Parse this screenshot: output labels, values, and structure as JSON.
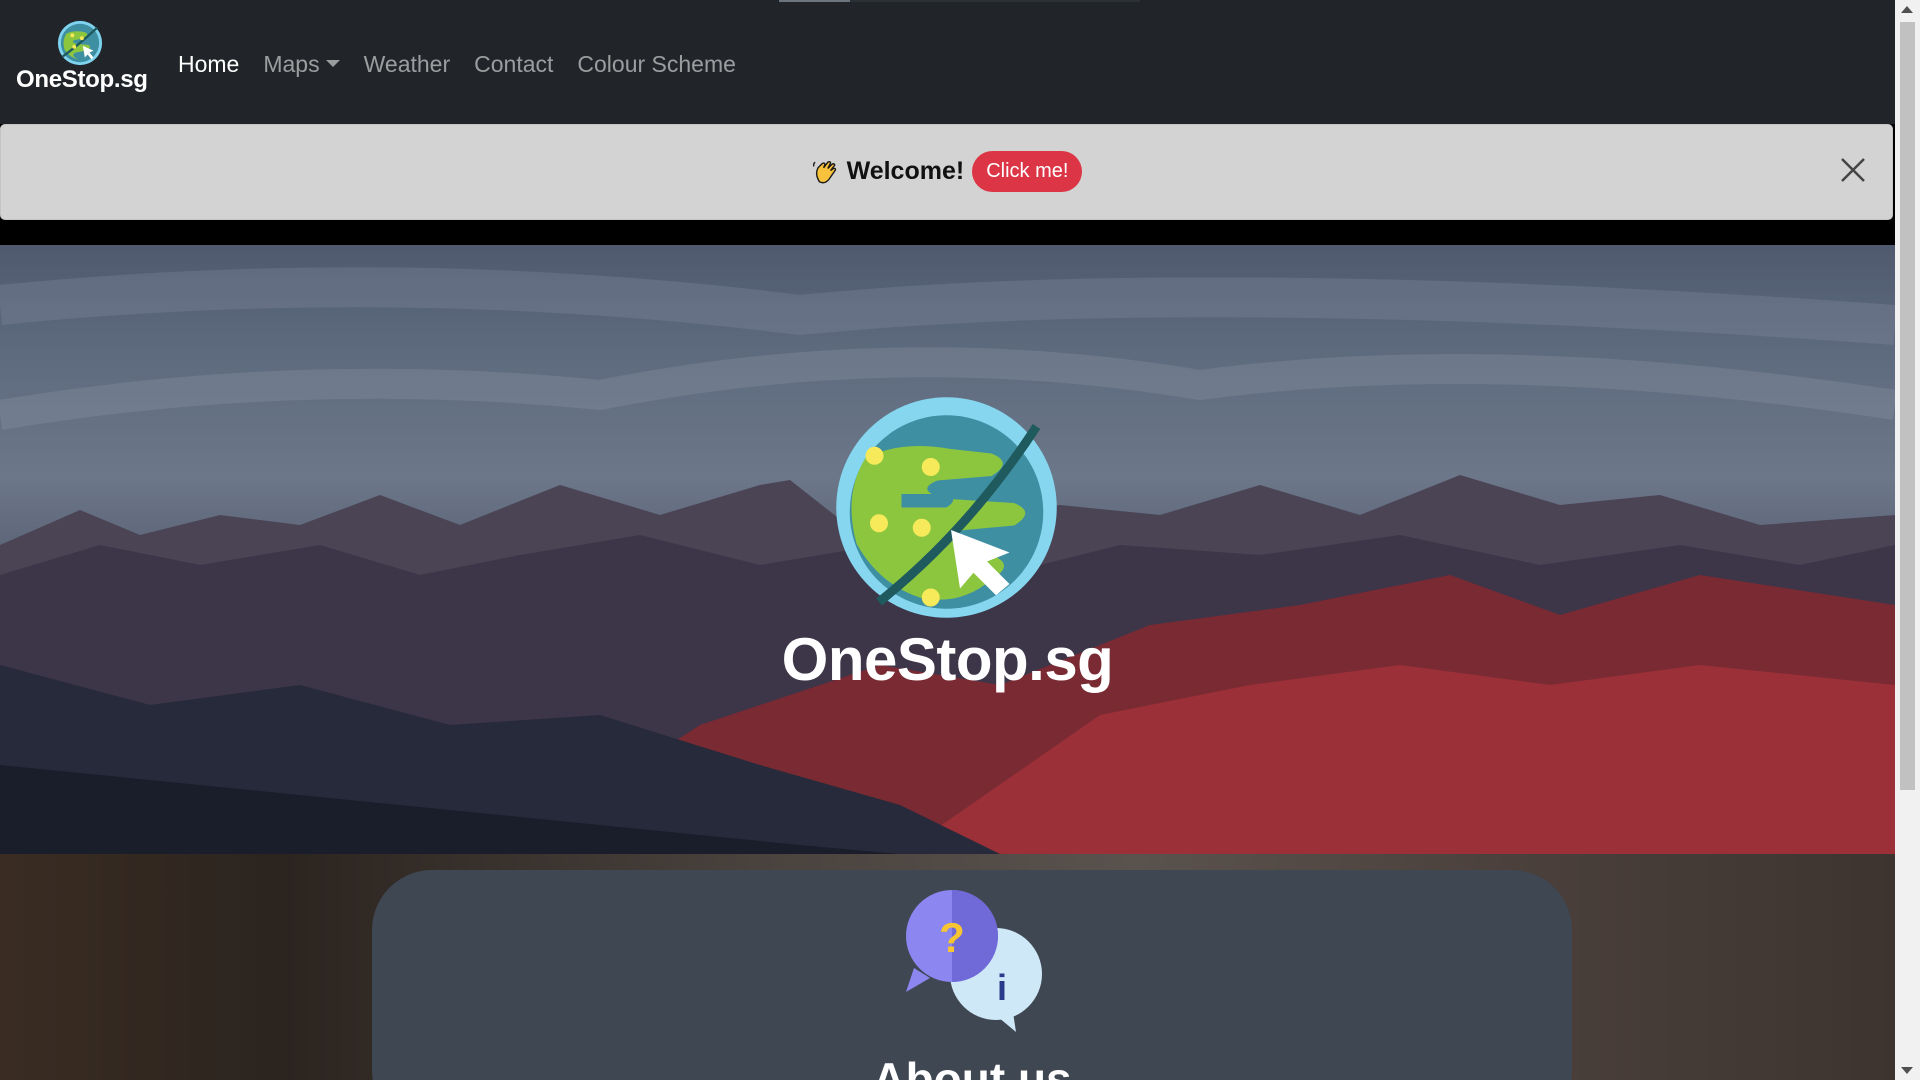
{
  "navbar": {
    "brand": "OneStop.sg",
    "links": [
      {
        "label": "Home",
        "active": true
      },
      {
        "label": "Maps",
        "dropdown": true
      },
      {
        "label": "Weather"
      },
      {
        "label": "Contact"
      },
      {
        "label": "Colour Scheme"
      }
    ]
  },
  "alert": {
    "icon": "waving-hand-icon",
    "text": "Welcome!",
    "button": "Click me!",
    "close_icon": "close-icon"
  },
  "hero": {
    "title": "OneStop.sg",
    "logo_icon": "globe-cursor-icon"
  },
  "about": {
    "icon": "question-info-bubbles-icon",
    "title": "About us"
  },
  "colors": {
    "navbar_bg": "#212529",
    "alert_bg": "#d3d3d3",
    "button_red": "#dc3545",
    "card_bg": "#3f4753"
  }
}
